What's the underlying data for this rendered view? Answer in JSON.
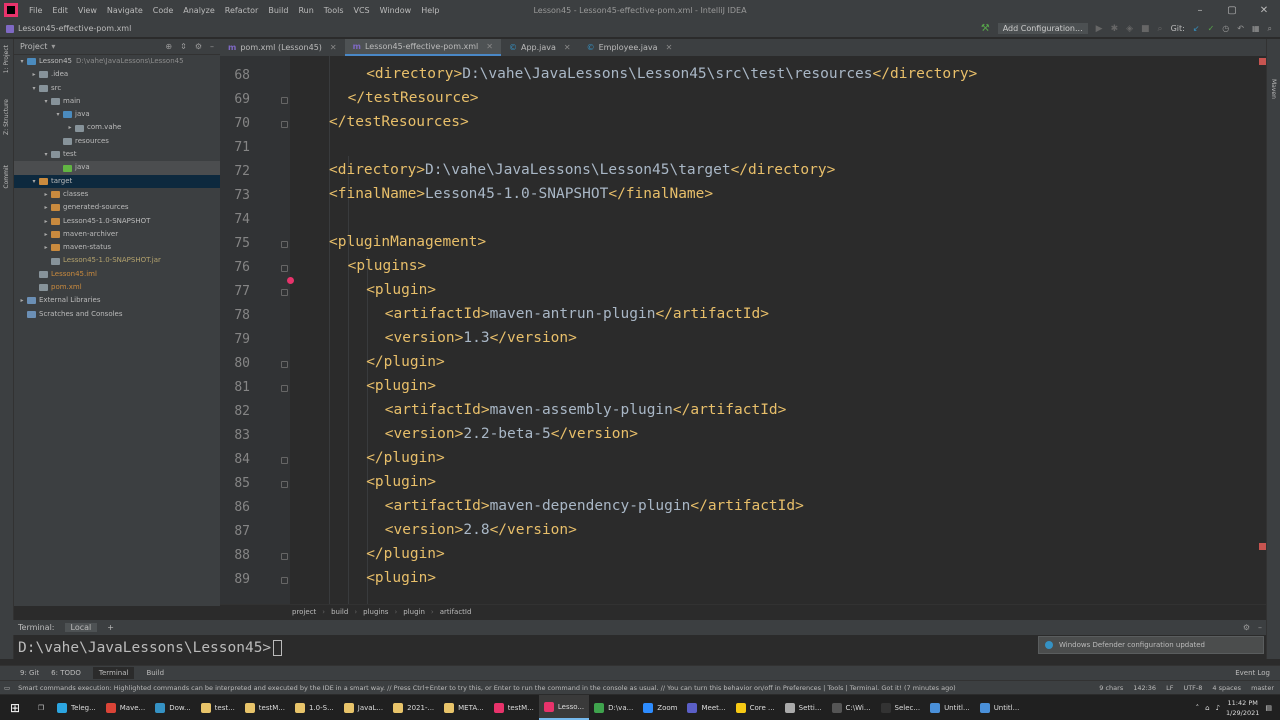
{
  "window": {
    "title": "Lesson45 - Lesson45-effective-pom.xml - IntelliJ IDEA",
    "menu": [
      "File",
      "Edit",
      "View",
      "Navigate",
      "Code",
      "Analyze",
      "Refactor",
      "Build",
      "Run",
      "Tools",
      "VCS",
      "Window",
      "Help"
    ]
  },
  "navbar": {
    "file": "Lesson45-effective-pom.xml",
    "add_config": "Add Configuration...",
    "git": "Git:"
  },
  "stripe": {
    "project": "1: Project",
    "structure": "Z: Structure",
    "commit": "Commit",
    "maven": "Maven"
  },
  "project": {
    "header": "Project",
    "tree": [
      {
        "label": "Lesson45",
        "path": "D:\\vahe\\JavaLessons\\Lesson45",
        "depth": 0,
        "tw": "▾",
        "icon": "blue"
      },
      {
        "label": ".idea",
        "depth": 1,
        "tw": "▸",
        "icon": "plain"
      },
      {
        "label": "src",
        "depth": 1,
        "tw": "▾",
        "icon": "plain"
      },
      {
        "label": "main",
        "depth": 2,
        "tw": "▾",
        "icon": "plain"
      },
      {
        "label": "java",
        "depth": 3,
        "tw": "▾",
        "icon": "blue"
      },
      {
        "label": "com.vahe",
        "depth": 4,
        "tw": "▸",
        "icon": "plain"
      },
      {
        "label": "resources",
        "depth": 3,
        "tw": "",
        "icon": "plain"
      },
      {
        "label": "test",
        "depth": 2,
        "tw": "▾",
        "icon": "plain"
      },
      {
        "label": "java",
        "depth": 3,
        "tw": "",
        "icon": "green"
      },
      {
        "label": "target",
        "depth": 1,
        "tw": "▾",
        "icon": "orange"
      },
      {
        "label": "classes",
        "depth": 2,
        "tw": "▸",
        "icon": "orange"
      },
      {
        "label": "generated-sources",
        "depth": 2,
        "tw": "▸",
        "icon": "orange"
      },
      {
        "label": "Lesson45-1.0-SNAPSHOT",
        "depth": 2,
        "tw": "▸",
        "icon": "orange"
      },
      {
        "label": "maven-archiver",
        "depth": 2,
        "tw": "▸",
        "icon": "orange"
      },
      {
        "label": "maven-status",
        "depth": 2,
        "tw": "▸",
        "icon": "orange"
      },
      {
        "label": "Lesson45-1.0-SNAPSHOT.jar",
        "depth": 2,
        "tw": "",
        "icon": "plain"
      },
      {
        "label": "Lesson45.iml",
        "depth": 1,
        "tw": "",
        "icon": "plain"
      },
      {
        "label": "pom.xml",
        "depth": 1,
        "tw": "",
        "icon": "plain"
      },
      {
        "label": "External Libraries",
        "depth": 0,
        "tw": "▸",
        "icon": "lib"
      },
      {
        "label": "Scratches and Consoles",
        "depth": 0,
        "tw": "",
        "icon": "lib"
      }
    ]
  },
  "tabs": [
    {
      "label": "pom.xml (Lesson45)",
      "icon": "m",
      "active": false
    },
    {
      "label": "Lesson45-effective-pom.xml",
      "icon": "m",
      "active": true
    },
    {
      "label": "App.java",
      "icon": "c",
      "active": false
    },
    {
      "label": "Employee.java",
      "icon": "c",
      "active": false
    }
  ],
  "code": [
    {
      "n": "68",
      "indent": 2,
      "text": "<directory>D:\\vahe\\JavaLessons\\Lesson45\\src\\test\\resources</directory>"
    },
    {
      "n": "69",
      "indent": 1,
      "text": "</testResource>"
    },
    {
      "n": "70",
      "indent": 0,
      "text": "</testResources>"
    },
    {
      "n": "71",
      "indent": 0,
      "text": ""
    },
    {
      "n": "72",
      "indent": 0,
      "text": "<directory>D:\\vahe\\JavaLessons\\Lesson45\\target</directory>"
    },
    {
      "n": "73",
      "indent": 0,
      "text": "<finalName>Lesson45-1.0-SNAPSHOT</finalName>"
    },
    {
      "n": "74",
      "indent": 0,
      "text": ""
    },
    {
      "n": "75",
      "indent": 0,
      "text": "<pluginManagement>"
    },
    {
      "n": "76",
      "indent": 1,
      "text": "<plugins>"
    },
    {
      "n": "77",
      "indent": 2,
      "text": "<plugin>"
    },
    {
      "n": "78",
      "indent": 3,
      "text": "<artifactId>maven-antrun-plugin</artifactId>"
    },
    {
      "n": "79",
      "indent": 3,
      "text": "<version>1.3</version>"
    },
    {
      "n": "80",
      "indent": 2,
      "text": "</plugin>"
    },
    {
      "n": "81",
      "indent": 2,
      "text": "<plugin>"
    },
    {
      "n": "82",
      "indent": 3,
      "text": "<artifactId>maven-assembly-plugin</artifactId>"
    },
    {
      "n": "83",
      "indent": 3,
      "text": "<version>2.2-beta-5</version>"
    },
    {
      "n": "84",
      "indent": 2,
      "text": "</plugin>"
    },
    {
      "n": "85",
      "indent": 2,
      "text": "<plugin>"
    },
    {
      "n": "86",
      "indent": 3,
      "text": "<artifactId>maven-dependency-plugin</artifactId>"
    },
    {
      "n": "87",
      "indent": 3,
      "text": "<version>2.8</version>"
    },
    {
      "n": "88",
      "indent": 2,
      "text": "</plugin>"
    },
    {
      "n": "89",
      "indent": 2,
      "text": "<plugin>"
    }
  ],
  "breadcrumb": [
    "project",
    "build",
    "plugins",
    "plugin",
    "artifactId"
  ],
  "terminal": {
    "label": "Terminal:",
    "tab": "Local",
    "prompt": "D:\\vahe\\JavaLessons\\Lesson45>"
  },
  "notification": "Windows Defender configuration updated",
  "tool_windows": [
    "9: Git",
    "6: TODO",
    "Terminal",
    "Build"
  ],
  "event_log": "Event Log",
  "status": {
    "message": "Smart commands execution: Highlighted commands can be interpreted and executed by the IDE in a smart way. // Press Ctrl+Enter to try this, or Enter to run the command in the console as usual. // You can turn this behavior on/off in Preferences | Tools | Terminal. Got it! (7 minutes ago)",
    "chars": "9 chars",
    "position": "142:36",
    "line_sep": "LF",
    "encoding": "UTF-8",
    "indent": "4 spaces",
    "branch": "master"
  },
  "taskbar": {
    "apps": [
      "Teleg...",
      "Mave...",
      "Dow...",
      "test...",
      "testM...",
      "1.0-S...",
      "JavaL...",
      "2021-...",
      "META...",
      "testM...",
      "Lesso...",
      "D:\\va...",
      "Zoom",
      "Meet...",
      "Core ...",
      "Setti...",
      "C:\\Wi...",
      "Selec...",
      "Untitl...",
      "Untitl..."
    ],
    "app_colors": [
      "#2ca5e0",
      "#db4437",
      "#3592c4",
      "#e8c46a",
      "#e8c46a",
      "#e8c46a",
      "#e8c46a",
      "#e8c46a",
      "#e8c46a",
      "#e8336b",
      "#e8336b",
      "#3fa34d",
      "#2d8cff",
      "#5b5fc7",
      "#f6c915",
      "#aaaaaa",
      "#555555",
      "#333333",
      "#4a90d9",
      "#4a90d9"
    ],
    "time": "11:42 PM",
    "date": "1/29/2021"
  }
}
